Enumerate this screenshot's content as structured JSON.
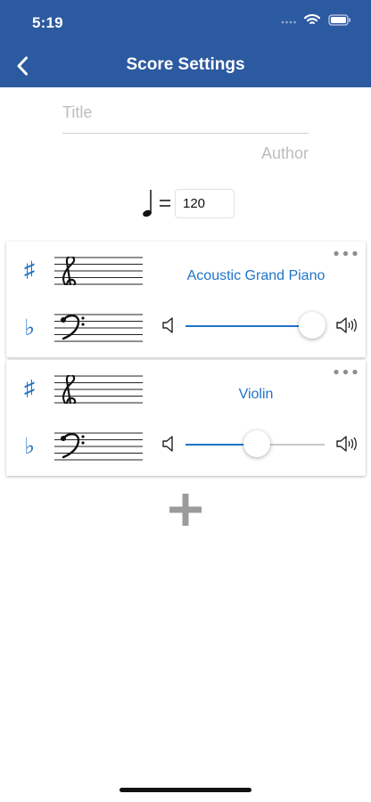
{
  "status": {
    "time": "5:19",
    "icons": [
      "cellular-signal-icon",
      "wifi-icon",
      "battery-icon"
    ]
  },
  "navigation": {
    "title": "Score Settings",
    "back_icon": "chevron-left-icon"
  },
  "score": {
    "title_placeholder": "Title",
    "author_placeholder": "Author",
    "tempo_value": "120"
  },
  "instruments": [
    {
      "name": "Acoustic Grand Piano",
      "volume": 0.91
    },
    {
      "name": "Violin",
      "volume": 0.51
    }
  ],
  "accidentals": {
    "sharp": "♯",
    "flat": "♭"
  },
  "colors": {
    "header": "#2c5aa0",
    "accent": "#1f73c8",
    "placeholder": "#bdbdbd"
  }
}
